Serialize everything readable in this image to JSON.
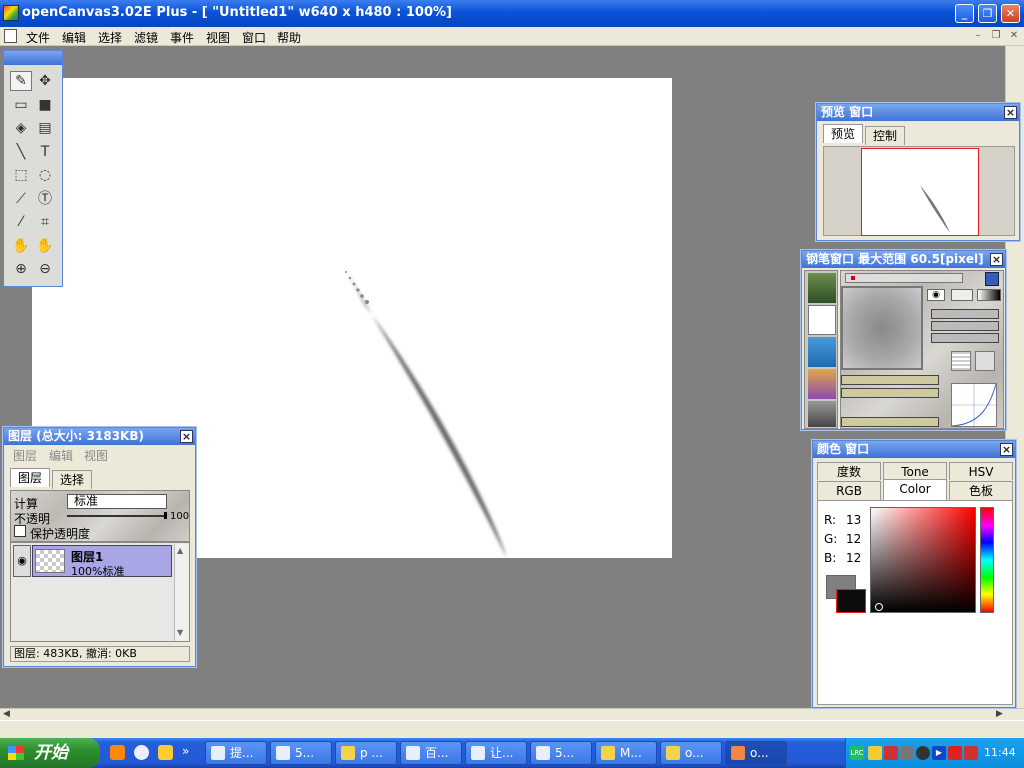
{
  "window": {
    "title": "openCanvas3.02E Plus - [ \"Untitled1\" w640 x h480 : 100%]",
    "buttons": {
      "minimize": "_",
      "restore": "❐",
      "close": "✕"
    }
  },
  "menu": {
    "items": [
      "文件",
      "编辑",
      "选择",
      "滤镜",
      "事件",
      "视图",
      "窗口",
      "帮助"
    ],
    "mdi": {
      "minimize": "–",
      "restore": "❐",
      "close": "✕"
    }
  },
  "toolbox": {
    "tools": [
      {
        "name": "pen-tool",
        "glyph": "✎",
        "selected": true
      },
      {
        "name": "move-tool",
        "glyph": "✥"
      },
      {
        "name": "eraser-tool",
        "glyph": "▭"
      },
      {
        "name": "color-swatch-tool",
        "glyph": "■"
      },
      {
        "name": "fill-tool",
        "glyph": "◈"
      },
      {
        "name": "gradient-tool",
        "glyph": "▤"
      },
      {
        "name": "line-tool",
        "glyph": "╲"
      },
      {
        "name": "text-tool",
        "glyph": "T"
      },
      {
        "name": "rect-select-tool",
        "glyph": "⬚"
      },
      {
        "name": "lasso-tool",
        "glyph": "◌"
      },
      {
        "name": "magic-wand-tool",
        "glyph": "⟋"
      },
      {
        "name": "text-select-tool",
        "glyph": "Ⓣ"
      },
      {
        "name": "eyedropper-tool",
        "glyph": "⁄"
      },
      {
        "name": "crop-tool",
        "glyph": "⌗"
      },
      {
        "name": "hand-tool",
        "glyph": "✋"
      },
      {
        "name": "rotate-hand-tool",
        "glyph": "✋"
      },
      {
        "name": "zoom-in-tool",
        "glyph": "⊕"
      },
      {
        "name": "zoom-out-tool",
        "glyph": "⊖"
      }
    ]
  },
  "preview": {
    "title": "预览 窗口",
    "tabs": [
      "预览",
      "控制"
    ]
  },
  "pen": {
    "title": "钢笔窗口  最大范围 60.5[pixel]"
  },
  "layers": {
    "title": "图层 (总大小: 3183KB)",
    "menu": [
      "图层",
      "编辑",
      "视图"
    ],
    "tabs": [
      "图层",
      "选择"
    ],
    "calc_label": "计算",
    "blend_mode": "标准",
    "opacity_label": "不透明",
    "opacity_value": "100",
    "opacity": 1.0,
    "protect_label": "保护透明度",
    "layer_name": "图层1",
    "layer_desc": "100%标准",
    "status": "图层: 483KB, 撤消: 0KB"
  },
  "color": {
    "title": "颜色 窗口",
    "tabs_row1": [
      "度数",
      "Tone",
      "HSV"
    ],
    "tabs_row2": [
      "RGB",
      "Color",
      "色板"
    ],
    "active_tab": "Color",
    "r_label": "R:",
    "r": "13",
    "g_label": "G:",
    "g": "12",
    "b_label": "B:",
    "b": "12",
    "foreground": "#0d0c0c",
    "background": "#808080"
  },
  "taskbar": {
    "start": "开始",
    "tasks": [
      {
        "label": "提...",
        "color": "#e8f0ff"
      },
      {
        "label": "5...",
        "color": "#e8f0ff"
      },
      {
        "label": "p ...",
        "color": "#f4d24a"
      },
      {
        "label": "百...",
        "color": "#e8f0ff"
      },
      {
        "label": "让...",
        "color": "#e8f0ff"
      },
      {
        "label": "5...",
        "color": "#e8f0ff"
      },
      {
        "label": "M...",
        "color": "#f4d24a"
      },
      {
        "label": "o...",
        "color": "#f4d24a"
      },
      {
        "label": "o...",
        "color": "#e84",
        "active": true
      }
    ],
    "clock": "11:44"
  }
}
